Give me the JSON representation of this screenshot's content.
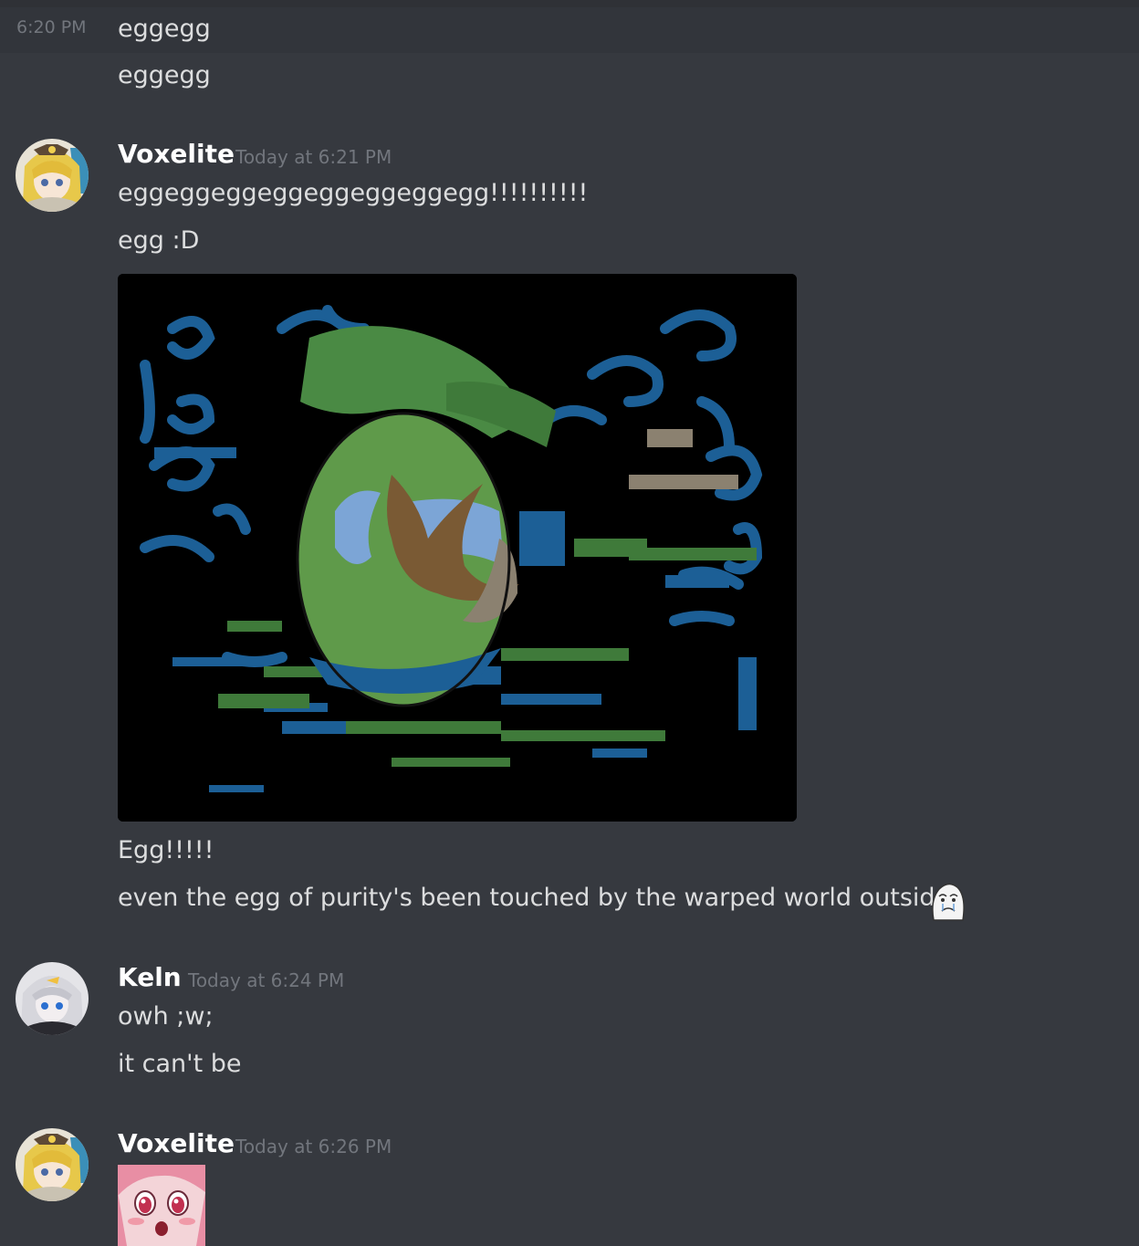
{
  "colors": {
    "background": "#36393f",
    "hover_row": "#32353b",
    "text": "#dcddde",
    "muted": "#72767d",
    "username": "#ffffff"
  },
  "messages": {
    "continuation": {
      "timestamp": "6:20 PM",
      "lines": [
        "eggegg",
        "eggegg"
      ]
    },
    "voxelite_1": {
      "author": "Voxelite",
      "timestamp": "Today at 6:21 PM",
      "lines": [
        "eggeggeggeggeggeggeggegg!!!!!!!!!!",
        "egg :D"
      ],
      "attachment_icon": "egg-tree-glitch-image",
      "after_lines": [
        "Egg!!!!!",
        "even the egg of purity's been touched by the warped world outside"
      ],
      "emoji_icon": "crying-face-emoji"
    },
    "keln": {
      "author": "Keln",
      "timestamp": "Today at 6:24 PM",
      "lines": [
        "owh ;w;",
        "it can't be"
      ]
    },
    "voxelite_2": {
      "author": "Voxelite",
      "timestamp": "Today at 6:26 PM",
      "sticker_icon": "anime-girl-shocked-sticker"
    }
  }
}
